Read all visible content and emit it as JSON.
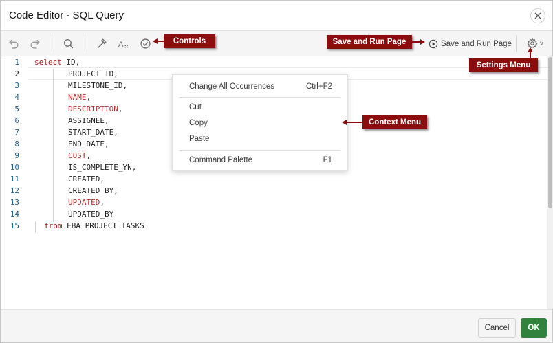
{
  "dialog": {
    "title": "Code Editor - SQL Query"
  },
  "toolbar": {
    "save_run_label": "Save and Run Page"
  },
  "editor": {
    "line_numbers": [
      "1",
      "2",
      "3",
      "4",
      "5",
      "6",
      "7",
      "8",
      "9",
      "10",
      "11",
      "12",
      "13",
      "14",
      "15"
    ],
    "lines": [
      {
        "kw": "select",
        "text": " ID,"
      },
      {
        "kw": "",
        "text": "PROJECT_ID,"
      },
      {
        "kw": "",
        "text": "MILESTONE_ID,"
      },
      {
        "red": "NAME",
        "text": ","
      },
      {
        "red": "DESCRIPTION",
        "text": ","
      },
      {
        "kw": "",
        "text": "ASSIGNEE,"
      },
      {
        "kw": "",
        "text": "START_DATE,"
      },
      {
        "kw": "",
        "text": "END_DATE,"
      },
      {
        "red": "COST",
        "text": ","
      },
      {
        "kw": "",
        "text": "IS_COMPLETE_YN,"
      },
      {
        "kw": "",
        "text": "CREATED,"
      },
      {
        "kw": "",
        "text": "CREATED_BY,"
      },
      {
        "red": "UPDATED",
        "text": ","
      },
      {
        "kw": "",
        "text": "UPDATED_BY"
      },
      {
        "kw": "from",
        "text": " EBA_PROJECT_TASKS"
      }
    ]
  },
  "context_menu": {
    "items": [
      {
        "label": "Change All Occurrences",
        "shortcut": "Ctrl+F2"
      },
      {
        "label": "Cut",
        "shortcut": ""
      },
      {
        "label": "Copy",
        "shortcut": ""
      },
      {
        "label": "Paste",
        "shortcut": ""
      },
      {
        "label": "Command Palette",
        "shortcut": "F1"
      }
    ]
  },
  "footer": {
    "cancel_label": "Cancel",
    "ok_label": "OK"
  },
  "callouts": {
    "controls": "Controls",
    "save_run": "Save and Run Page",
    "settings_menu": "Settings Menu",
    "context_menu": "Context Menu"
  },
  "colors": {
    "callout_bg": "#8b0d0d",
    "ok_button": "#30823c",
    "keyword": "#a41c1c",
    "line_number": "#1f5f8b"
  },
  "icons": [
    "close-icon",
    "undo-icon",
    "redo-icon",
    "search-icon",
    "hammer-icon",
    "text-case-icon",
    "check-circle-icon",
    "play-circle-icon",
    "gear-icon",
    "chevron-down-icon"
  ]
}
